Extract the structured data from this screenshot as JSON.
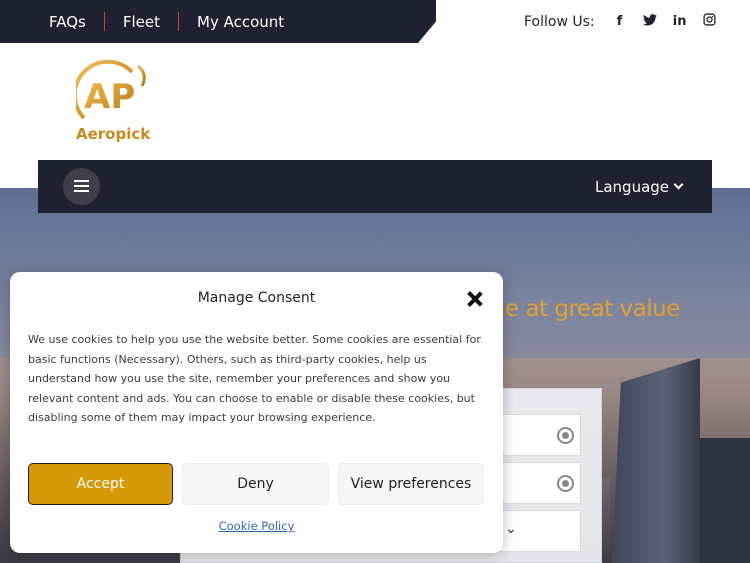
{
  "topbar": {
    "links": [
      "FAQs",
      "Fleet",
      "My Account"
    ],
    "follow_label": "Follow Us:",
    "social": [
      "facebook-icon",
      "twitter-icon",
      "linkedin-icon",
      "instagram-icon"
    ]
  },
  "brand": {
    "name": "Aeropick",
    "monogram": "AP"
  },
  "nav": {
    "language_label": "Language"
  },
  "hero": {
    "tagline_fragment": "e at great value"
  },
  "consent": {
    "title": "Manage Consent",
    "body": "We use cookies to help you use the website better. Some cookies are essential for basic functions (Necessary). Others, such as third-party cookies, help us understand how you use the site, remember your preferences and show you relevant content and ads. You can choose to enable or disable these cookies, but disabling some of them may impact your browsing experience.",
    "accept_label": "Accept",
    "deny_label": "Deny",
    "prefs_label": "View preferences",
    "policy_link": "Cookie Policy"
  },
  "colors": {
    "dark": "#1f2230",
    "accent": "#d69a08",
    "brand_gold": "#c8891d",
    "link": "#2b68b5"
  }
}
